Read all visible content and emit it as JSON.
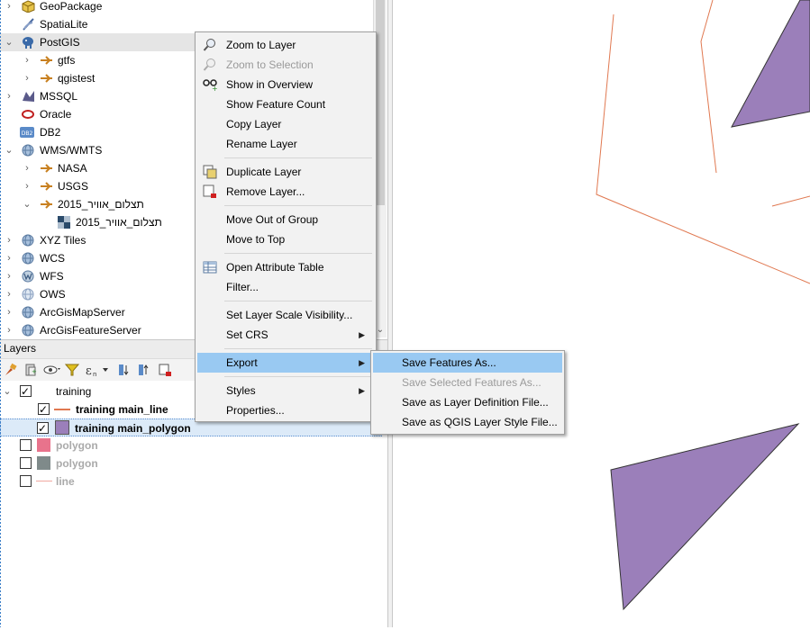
{
  "browser": {
    "items": [
      {
        "label": "GeoPackage",
        "icon": "geopackage-icon"
      },
      {
        "label": "SpatiaLite",
        "icon": "spatialite-icon"
      },
      {
        "label": "PostGIS",
        "icon": "postgis-elephant-icon"
      },
      {
        "label": "gtfs",
        "icon": "connection-icon"
      },
      {
        "label": "qgistest",
        "icon": "connection-icon"
      },
      {
        "label": "MSSQL",
        "icon": "mssql-icon"
      },
      {
        "label": "Oracle",
        "icon": "oracle-icon"
      },
      {
        "label": "DB2",
        "icon": "db2-icon"
      },
      {
        "label": "WMS/WMTS",
        "icon": "globe-icon"
      },
      {
        "label": "NASA",
        "icon": "connection-icon"
      },
      {
        "label": "USGS",
        "icon": "connection-icon"
      },
      {
        "label": "תצלום_אוויר_2015",
        "icon": "connection-icon"
      },
      {
        "label": "תצלום_אוויר_2015",
        "icon": "raster-layer-icon"
      },
      {
        "label": "XYZ Tiles",
        "icon": "globe-icon"
      },
      {
        "label": "WCS",
        "icon": "globe-icon"
      },
      {
        "label": "WFS",
        "icon": "wfs-icon"
      },
      {
        "label": "OWS",
        "icon": "globe-icon"
      },
      {
        "label": "ArcGisMapServer",
        "icon": "globe-icon"
      },
      {
        "label": "ArcGisFeatureServer",
        "icon": "globe-icon"
      }
    ]
  },
  "layers": {
    "title": "Layers",
    "toolbar": [
      "style-manager-icon",
      "add-group-icon",
      "visibility-eye-icon",
      "filter-icon",
      "expression-filter-icon",
      "expand-all-icon",
      "collapse-all-icon",
      "remove-layer-icon"
    ],
    "items": [
      {
        "label": "training",
        "checked": true
      },
      {
        "label": "training main_line",
        "checked": true
      },
      {
        "label": "training main_polygon",
        "checked": true
      },
      {
        "label": "polygon",
        "checked": false
      },
      {
        "label": "polygon",
        "checked": false
      },
      {
        "label": "line",
        "checked": false
      }
    ]
  },
  "context_menu": {
    "items": [
      {
        "label": "Zoom to Layer",
        "enabled": true,
        "icon": "zoom-to-layer-icon"
      },
      {
        "label": "Zoom to Selection",
        "enabled": false,
        "icon": "zoom-to-selection-icon"
      },
      {
        "label": "Show in Overview",
        "enabled": true,
        "icon": "overview-glasses-icon"
      },
      {
        "label": "Show Feature Count",
        "enabled": true
      },
      {
        "label": "Copy Layer",
        "enabled": true
      },
      {
        "label": "Rename Layer",
        "enabled": true
      },
      {
        "label": "Duplicate Layer",
        "enabled": true,
        "icon": "duplicate-layer-icon"
      },
      {
        "label": "Remove Layer...",
        "enabled": true,
        "icon": "remove-layer-icon"
      },
      {
        "label": "Move Out of Group",
        "enabled": true
      },
      {
        "label": "Move to Top",
        "enabled": true
      },
      {
        "label": "Open Attribute Table",
        "enabled": true,
        "icon": "attribute-table-icon"
      },
      {
        "label": "Filter...",
        "enabled": true
      },
      {
        "label": "Set Layer Scale Visibility...",
        "enabled": true
      },
      {
        "label": "Set CRS",
        "enabled": true,
        "submenu": true
      },
      {
        "label": "Export",
        "enabled": true,
        "submenu": true,
        "highlighted": true
      },
      {
        "label": "Styles",
        "enabled": true,
        "submenu": true
      },
      {
        "label": "Properties...",
        "enabled": true
      }
    ]
  },
  "export_submenu": {
    "items": [
      {
        "label": "Save Features As...",
        "enabled": true,
        "highlighted": true
      },
      {
        "label": "Save Selected Features As...",
        "enabled": false
      },
      {
        "label": "Save as Layer Definition File...",
        "enabled": true
      },
      {
        "label": "Save as QGIS Layer Style File...",
        "enabled": true
      }
    ]
  },
  "colors": {
    "polygon_fill": "#9b7fba",
    "line_stroke": "#e07850",
    "menu_highlight": "#99c9f2",
    "swatch_pink": "#e8738c",
    "swatch_grey": "#7f8a8a"
  }
}
